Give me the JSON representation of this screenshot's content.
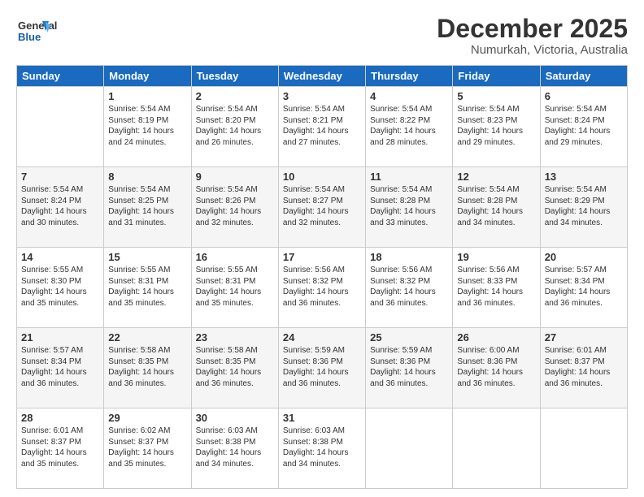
{
  "header": {
    "logo": {
      "line1": "General",
      "line2": "Blue"
    },
    "title": "December 2025",
    "subtitle": "Numurkah, Victoria, Australia"
  },
  "days": [
    "Sunday",
    "Monday",
    "Tuesday",
    "Wednesday",
    "Thursday",
    "Friday",
    "Saturday"
  ],
  "weeks": [
    [
      {
        "day": "",
        "sunrise": "",
        "sunset": "",
        "daylight": ""
      },
      {
        "day": "1",
        "sunrise": "Sunrise: 5:54 AM",
        "sunset": "Sunset: 8:19 PM",
        "daylight": "Daylight: 14 hours and 24 minutes."
      },
      {
        "day": "2",
        "sunrise": "Sunrise: 5:54 AM",
        "sunset": "Sunset: 8:20 PM",
        "daylight": "Daylight: 14 hours and 26 minutes."
      },
      {
        "day": "3",
        "sunrise": "Sunrise: 5:54 AM",
        "sunset": "Sunset: 8:21 PM",
        "daylight": "Daylight: 14 hours and 27 minutes."
      },
      {
        "day": "4",
        "sunrise": "Sunrise: 5:54 AM",
        "sunset": "Sunset: 8:22 PM",
        "daylight": "Daylight: 14 hours and 28 minutes."
      },
      {
        "day": "5",
        "sunrise": "Sunrise: 5:54 AM",
        "sunset": "Sunset: 8:23 PM",
        "daylight": "Daylight: 14 hours and 29 minutes."
      },
      {
        "day": "6",
        "sunrise": "Sunrise: 5:54 AM",
        "sunset": "Sunset: 8:24 PM",
        "daylight": "Daylight: 14 hours and 29 minutes."
      }
    ],
    [
      {
        "day": "7",
        "sunrise": "Sunrise: 5:54 AM",
        "sunset": "Sunset: 8:24 PM",
        "daylight": "Daylight: 14 hours and 30 minutes."
      },
      {
        "day": "8",
        "sunrise": "Sunrise: 5:54 AM",
        "sunset": "Sunset: 8:25 PM",
        "daylight": "Daylight: 14 hours and 31 minutes."
      },
      {
        "day": "9",
        "sunrise": "Sunrise: 5:54 AM",
        "sunset": "Sunset: 8:26 PM",
        "daylight": "Daylight: 14 hours and 32 minutes."
      },
      {
        "day": "10",
        "sunrise": "Sunrise: 5:54 AM",
        "sunset": "Sunset: 8:27 PM",
        "daylight": "Daylight: 14 hours and 32 minutes."
      },
      {
        "day": "11",
        "sunrise": "Sunrise: 5:54 AM",
        "sunset": "Sunset: 8:28 PM",
        "daylight": "Daylight: 14 hours and 33 minutes."
      },
      {
        "day": "12",
        "sunrise": "Sunrise: 5:54 AM",
        "sunset": "Sunset: 8:28 PM",
        "daylight": "Daylight: 14 hours and 34 minutes."
      },
      {
        "day": "13",
        "sunrise": "Sunrise: 5:54 AM",
        "sunset": "Sunset: 8:29 PM",
        "daylight": "Daylight: 14 hours and 34 minutes."
      }
    ],
    [
      {
        "day": "14",
        "sunrise": "Sunrise: 5:55 AM",
        "sunset": "Sunset: 8:30 PM",
        "daylight": "Daylight: 14 hours and 35 minutes."
      },
      {
        "day": "15",
        "sunrise": "Sunrise: 5:55 AM",
        "sunset": "Sunset: 8:31 PM",
        "daylight": "Daylight: 14 hours and 35 minutes."
      },
      {
        "day": "16",
        "sunrise": "Sunrise: 5:55 AM",
        "sunset": "Sunset: 8:31 PM",
        "daylight": "Daylight: 14 hours and 35 minutes."
      },
      {
        "day": "17",
        "sunrise": "Sunrise: 5:56 AM",
        "sunset": "Sunset: 8:32 PM",
        "daylight": "Daylight: 14 hours and 36 minutes."
      },
      {
        "day": "18",
        "sunrise": "Sunrise: 5:56 AM",
        "sunset": "Sunset: 8:32 PM",
        "daylight": "Daylight: 14 hours and 36 minutes."
      },
      {
        "day": "19",
        "sunrise": "Sunrise: 5:56 AM",
        "sunset": "Sunset: 8:33 PM",
        "daylight": "Daylight: 14 hours and 36 minutes."
      },
      {
        "day": "20",
        "sunrise": "Sunrise: 5:57 AM",
        "sunset": "Sunset: 8:34 PM",
        "daylight": "Daylight: 14 hours and 36 minutes."
      }
    ],
    [
      {
        "day": "21",
        "sunrise": "Sunrise: 5:57 AM",
        "sunset": "Sunset: 8:34 PM",
        "daylight": "Daylight: 14 hours and 36 minutes."
      },
      {
        "day": "22",
        "sunrise": "Sunrise: 5:58 AM",
        "sunset": "Sunset: 8:35 PM",
        "daylight": "Daylight: 14 hours and 36 minutes."
      },
      {
        "day": "23",
        "sunrise": "Sunrise: 5:58 AM",
        "sunset": "Sunset: 8:35 PM",
        "daylight": "Daylight: 14 hours and 36 minutes."
      },
      {
        "day": "24",
        "sunrise": "Sunrise: 5:59 AM",
        "sunset": "Sunset: 8:36 PM",
        "daylight": "Daylight: 14 hours and 36 minutes."
      },
      {
        "day": "25",
        "sunrise": "Sunrise: 5:59 AM",
        "sunset": "Sunset: 8:36 PM",
        "daylight": "Daylight: 14 hours and 36 minutes."
      },
      {
        "day": "26",
        "sunrise": "Sunrise: 6:00 AM",
        "sunset": "Sunset: 8:36 PM",
        "daylight": "Daylight: 14 hours and 36 minutes."
      },
      {
        "day": "27",
        "sunrise": "Sunrise: 6:01 AM",
        "sunset": "Sunset: 8:37 PM",
        "daylight": "Daylight: 14 hours and 36 minutes."
      }
    ],
    [
      {
        "day": "28",
        "sunrise": "Sunrise: 6:01 AM",
        "sunset": "Sunset: 8:37 PM",
        "daylight": "Daylight: 14 hours and 35 minutes."
      },
      {
        "day": "29",
        "sunrise": "Sunrise: 6:02 AM",
        "sunset": "Sunset: 8:37 PM",
        "daylight": "Daylight: 14 hours and 35 minutes."
      },
      {
        "day": "30",
        "sunrise": "Sunrise: 6:03 AM",
        "sunset": "Sunset: 8:38 PM",
        "daylight": "Daylight: 14 hours and 34 minutes."
      },
      {
        "day": "31",
        "sunrise": "Sunrise: 6:03 AM",
        "sunset": "Sunset: 8:38 PM",
        "daylight": "Daylight: 14 hours and 34 minutes."
      },
      {
        "day": "",
        "sunrise": "",
        "sunset": "",
        "daylight": ""
      },
      {
        "day": "",
        "sunrise": "",
        "sunset": "",
        "daylight": ""
      },
      {
        "day": "",
        "sunrise": "",
        "sunset": "",
        "daylight": ""
      }
    ]
  ]
}
